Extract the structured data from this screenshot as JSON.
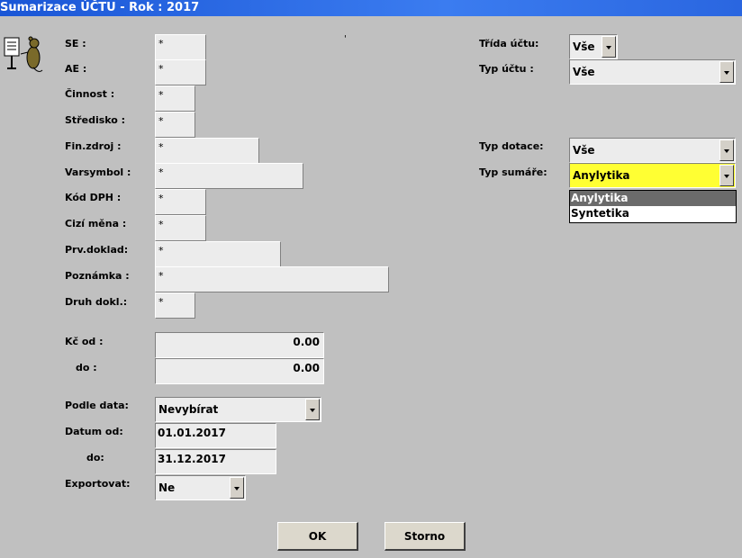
{
  "window": {
    "title": "Sumarizace ÚČTU - Rok : 2017"
  },
  "filters": {
    "se": {
      "label": "SE :",
      "value": "*"
    },
    "ae": {
      "label": "AE :",
      "value": "*"
    },
    "cinnost": {
      "label": "Činnost :",
      "value": "*"
    },
    "stredisko": {
      "label": "Středisko :",
      "value": "*"
    },
    "finzdroj": {
      "label": "Fin.zdroj :",
      "value": "*"
    },
    "varsymbol": {
      "label": "Varsymbol :",
      "value": "*"
    },
    "koddph": {
      "label": "Kód DPH :",
      "value": "*"
    },
    "cizimena": {
      "label": "Cizí měna :",
      "value": "*"
    },
    "prvdoklad": {
      "label": "Prv.doklad:",
      "value": "*"
    },
    "poznamka": {
      "label": "Poznámka :",
      "value": "*"
    },
    "druhdokl": {
      "label": "Druh dokl.:",
      "value": "*"
    }
  },
  "amount": {
    "from_label": "Kč od :",
    "from_value": "0.00",
    "to_label": "do :",
    "to_value": "0.00"
  },
  "date_mode": {
    "label": "Podle data:",
    "value": "Nevybírat"
  },
  "dates": {
    "from_label": "Datum od:",
    "from_value": "01.01.2017",
    "to_label": "do:",
    "to_value": "31.12.2017"
  },
  "export": {
    "label": "Exportovat:",
    "value": "Ne"
  },
  "right_panel": {
    "trida_label": "Třída účtu:",
    "trida_value": "Vše",
    "typuctu_label": "Typ účtu :",
    "typuctu_value": "Vše",
    "typdotace_label": "Typ dotace:",
    "typdotace_value": "Vše",
    "typsumare_label": "Typ sumáře:",
    "typsumare_value": "Anylytika",
    "typsumare_options": [
      "Anylytika",
      "Syntetika"
    ]
  },
  "buttons": {
    "ok": "OK",
    "storno": "Storno"
  },
  "colors": {
    "title_bar": "#2a66e0",
    "highlight": "#ffff33",
    "selected_option": "#6b6b6b"
  }
}
